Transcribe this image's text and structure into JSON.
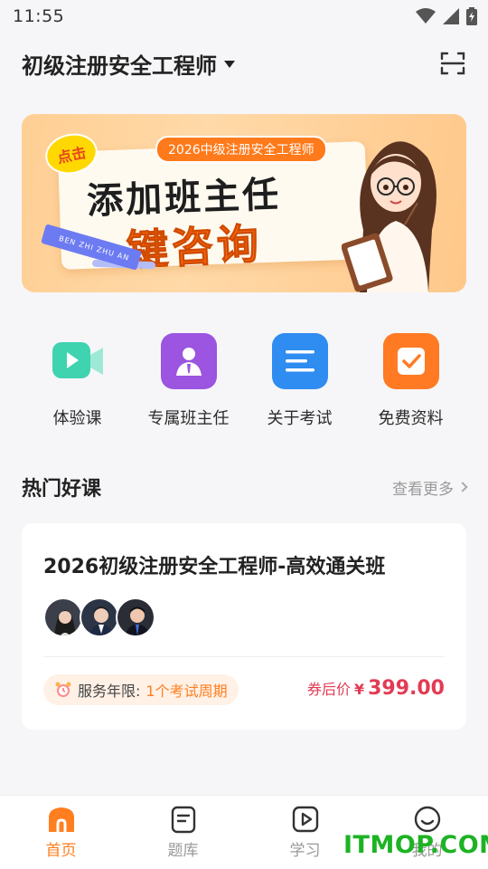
{
  "status_bar": {
    "time": "11:55"
  },
  "header": {
    "title": "初级注册安全工程师"
  },
  "banner": {
    "pill": "2026中级注册安全工程师",
    "burst": "点击",
    "line1": "添加班主任",
    "line2": "一键咨询",
    "ribbon": "BEN ZHI ZHU AN"
  },
  "quick_actions": [
    {
      "label": "体验课",
      "icon": "video-icon",
      "color": "#3fd3b0"
    },
    {
      "label": "专属班主任",
      "icon": "teacher-icon",
      "color": "#9b55e0"
    },
    {
      "label": "关于考试",
      "icon": "document-icon",
      "color": "#2f8cf0"
    },
    {
      "label": "免费资料",
      "icon": "checkbox-icon",
      "color": "#ff7a23"
    }
  ],
  "hot_section": {
    "title": "热门好课",
    "more": "查看更多"
  },
  "course": {
    "title": "2026初级注册安全工程师-高效通关班",
    "service_label": "服务年限:",
    "service_value": "1个考试周期",
    "price_label": "券后价",
    "currency": "¥",
    "price": "399.00"
  },
  "tabs": [
    {
      "label": "首页",
      "icon": "home-icon",
      "active": true
    },
    {
      "label": "题库",
      "icon": "question-bank-icon",
      "active": false
    },
    {
      "label": "学习",
      "icon": "play-icon",
      "active": false
    },
    {
      "label": "我的",
      "icon": "smile-icon",
      "active": false
    }
  ],
  "watermark": "ITMOP.COM",
  "colors": {
    "accent": "#ff7e1f",
    "price": "#e23b54"
  }
}
